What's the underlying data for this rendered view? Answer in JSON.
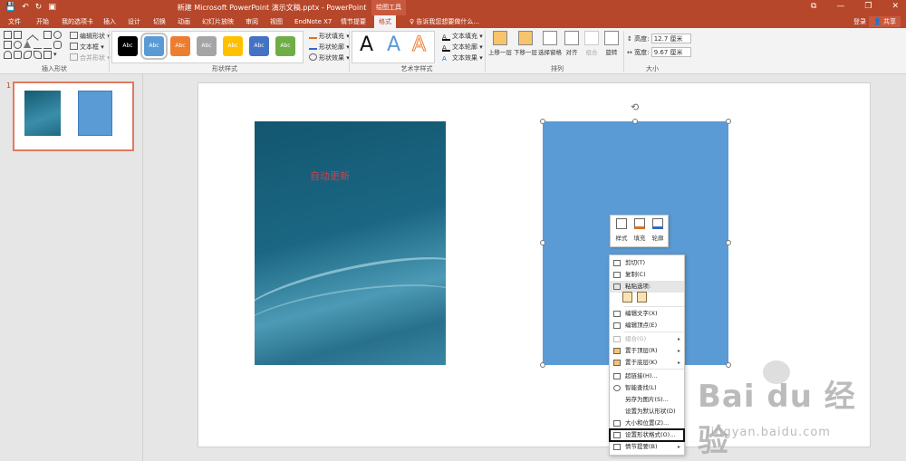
{
  "titlebar": {
    "title": "新建 Microsoft PowerPoint 演示文稿.pptx - PowerPoint",
    "context_tools": "绘图工具",
    "qat_icons": [
      "save-icon",
      "undo-icon",
      "redo-icon",
      "slideshow-icon"
    ],
    "window_controls": [
      "⧉",
      "—",
      "❐",
      "✕"
    ]
  },
  "tabs": [
    {
      "label": "文件"
    },
    {
      "label": "开始"
    },
    {
      "label": "我的选项卡"
    },
    {
      "label": "插入"
    },
    {
      "label": "设计"
    },
    {
      "label": "切换"
    },
    {
      "label": "动画"
    },
    {
      "label": "幻灯片放映"
    },
    {
      "label": "审阅"
    },
    {
      "label": "视图"
    },
    {
      "label": "EndNote X7"
    },
    {
      "label": "情节提要"
    },
    {
      "label": "格式"
    }
  ],
  "tell_me": "告诉我您想要做什么...",
  "login": "登录",
  "share": "共享",
  "ribbon": {
    "insert_shapes": {
      "label": "插入形状",
      "edit_shape": "编辑形状",
      "text_box": "文本框",
      "merge_shapes": "合并形状"
    },
    "shape_styles": {
      "label": "形状样式",
      "swatches": [
        {
          "text": "Abc",
          "color": "#000000"
        },
        {
          "text": "Abc",
          "color": "#5b9bd5"
        },
        {
          "text": "Abc",
          "color": "#ed7d31"
        },
        {
          "text": "Abc",
          "color": "#a5a5a5"
        },
        {
          "text": "Abc",
          "color": "#ffc000"
        },
        {
          "text": "Abc",
          "color": "#4472c4"
        },
        {
          "text": "Abc",
          "color": "#70ad47"
        }
      ],
      "fill": "形状填充",
      "outline": "形状轮廓",
      "effects": "形状效果"
    },
    "wordart": {
      "label": "艺术字样式",
      "letters": [
        "A",
        "A",
        "A"
      ],
      "text_fill": "文本填充",
      "text_outline": "文本轮廓",
      "text_effects": "文本效果"
    },
    "arrange": {
      "label": "排列",
      "bring_forward": "上移一层",
      "send_backward": "下移一层",
      "selection_pane": "选择窗格",
      "align": "对齐",
      "group": "组合",
      "rotate": "旋转"
    },
    "size": {
      "label": "大小",
      "height_label": "高度:",
      "height": "12.7 厘米",
      "width_label": "宽度:",
      "width": "9.67 厘米"
    }
  },
  "thumbnails": {
    "slide_number": "1"
  },
  "slide": {
    "image_text": "自动更新"
  },
  "mini_toolbar": {
    "style": "样式",
    "fill": "填充",
    "outline": "轮廓"
  },
  "context_menu": {
    "cut": "剪切(T)",
    "copy": "复制(C)",
    "paste_options": "粘贴选项:",
    "edit_text": "编辑文字(X)",
    "edit_points": "编辑顶点(E)",
    "group": "组合(G)",
    "bring_to_front": "置于顶层(R)",
    "send_to_back": "置于底层(K)",
    "hyperlink": "超链接(H)...",
    "smart_lookup": "智能查找(L)",
    "save_as_picture": "另存为图片(S)...",
    "set_default": "设置为默认形状(D)",
    "size_position": "大小和位置(Z)...",
    "format_shape": "设置形状格式(O)...",
    "storyboard": "情节提要(B)"
  },
  "watermark": {
    "logo": "Bai du 经验",
    "url": "jingyan.baidu.com"
  }
}
